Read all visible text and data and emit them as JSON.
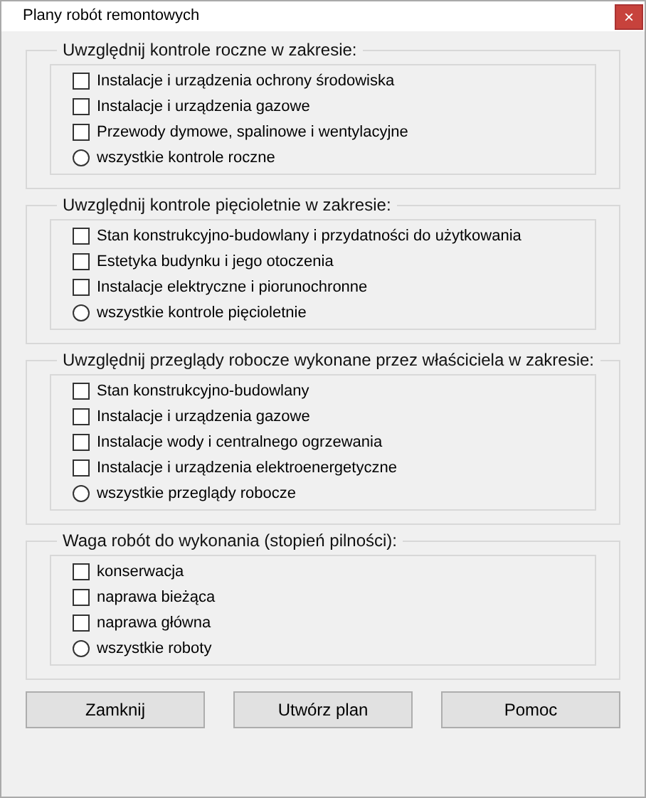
{
  "window": {
    "title": "Plany robót remontowych",
    "close": "×"
  },
  "groups": [
    {
      "title": "Uwzględnij kontrole roczne w zakresie:",
      "items": [
        {
          "kind": "checkbox",
          "label": "Instalacje i urządzenia ochrony środowiska",
          "checked": false
        },
        {
          "kind": "checkbox",
          "label": "Instalacje i urządzenia gazowe",
          "checked": false
        },
        {
          "kind": "checkbox",
          "label": "Przewody dymowe, spalinowe i wentylacyjne",
          "checked": false
        },
        {
          "kind": "radio",
          "label": "wszystkie kontrole roczne",
          "selected": false
        }
      ]
    },
    {
      "title": "Uwzględnij kontrole pięcioletnie w zakresie:",
      "items": [
        {
          "kind": "checkbox",
          "label": "Stan konstrukcyjno-budowlany i przydatności do użytkowania",
          "checked": false
        },
        {
          "kind": "checkbox",
          "label": "Estetyka budynku i jego otoczenia",
          "checked": false
        },
        {
          "kind": "checkbox",
          "label": "Instalacje elektryczne i piorunochronne",
          "checked": false
        },
        {
          "kind": "radio",
          "label": "wszystkie kontrole pięcioletnie",
          "selected": false
        }
      ]
    },
    {
      "title": "Uwzględnij przeglądy robocze wykonane przez właściciela w zakresie:",
      "items": [
        {
          "kind": "checkbox",
          "label": "Stan konstrukcyjno-budowlany",
          "checked": false
        },
        {
          "kind": "checkbox",
          "label": "Instalacje i urządzenia gazowe",
          "checked": false
        },
        {
          "kind": "checkbox",
          "label": "Instalacje wody i centralnego ogrzewania",
          "checked": false
        },
        {
          "kind": "checkbox",
          "label": "Instalacje i urządzenia elektroenergetyczne",
          "checked": false
        },
        {
          "kind": "radio",
          "label": "wszystkie przeglądy robocze",
          "selected": false
        }
      ]
    },
    {
      "title": "Waga robót do wykonania (stopień pilności):",
      "items": [
        {
          "kind": "checkbox",
          "label": "konserwacja",
          "checked": false
        },
        {
          "kind": "checkbox",
          "label": "naprawa bieżąca",
          "checked": false
        },
        {
          "kind": "checkbox",
          "label": "naprawa główna",
          "checked": false
        },
        {
          "kind": "radio",
          "label": "wszystkie roboty",
          "selected": false
        }
      ]
    }
  ],
  "buttons": [
    "Zamknij",
    "Utwórz plan",
    "Pomoc"
  ]
}
